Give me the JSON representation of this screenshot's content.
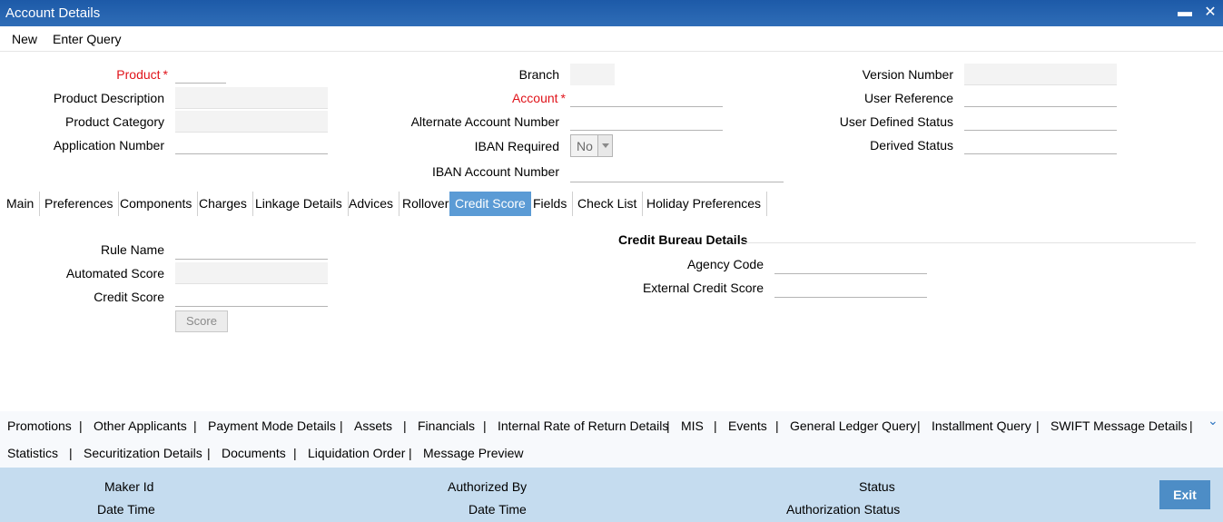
{
  "window": {
    "title": "Account Details",
    "minimize_glyph": "▬",
    "close_glyph": "✕"
  },
  "menu": {
    "new": "New",
    "enter_query": "Enter Query"
  },
  "header": {
    "product_label": "Product",
    "product_description_label": "Product Description",
    "product_category_label": "Product Category",
    "application_number_label": "Application Number",
    "branch_label": "Branch",
    "account_label": "Account",
    "alternate_account_label": "Alternate Account Number",
    "iban_required_label": "IBAN Required",
    "iban_required_value": "No",
    "iban_account_label": "IBAN Account Number",
    "version_number_label": "Version Number",
    "user_reference_label": "User Reference",
    "user_defined_status_label": "User Defined Status",
    "derived_status_label": "Derived Status",
    "required_marker": "*"
  },
  "tabs": [
    "Main",
    "Preferences",
    "Components",
    "Charges",
    "Linkage Details",
    "Advices",
    "Rollover",
    "Credit Score",
    "Fields",
    "Check List",
    "Holiday Preferences"
  ],
  "active_tab": "Credit Score",
  "credit_score": {
    "rule_name_label": "Rule Name",
    "automated_score_label": "Automated Score",
    "credit_score_label": "Credit Score",
    "score_button": "Score",
    "bureau_title": "Credit Bureau Details",
    "agency_code_label": "Agency Code",
    "external_credit_score_label": "External Credit Score"
  },
  "links": {
    "row1": [
      "Promotions",
      "Other Applicants",
      "Payment Mode Details",
      "Assets",
      "Financials",
      "Internal Rate of Return Details",
      "MIS",
      "Events",
      "General Ledger Query",
      "Installment Query",
      "SWIFT Message Details"
    ],
    "row2": [
      "Statistics",
      "Securitization Details",
      "Documents",
      "Liquidation Order",
      "Message Preview"
    ],
    "separator": "|",
    "expand_glyph": "⌄"
  },
  "footer": {
    "maker_id": "Maker Id",
    "date_time_1": "Date Time",
    "authorized_by": "Authorized By",
    "date_time_2": "Date Time",
    "status": "Status",
    "authorization_status": "Authorization Status",
    "exit": "Exit"
  },
  "colors": {
    "title_bar": "#2b66b1",
    "active_tab": "#5b9bd5",
    "required": "#e0131a",
    "footer": "#c5dcef",
    "exit_button": "#4d8dc6"
  }
}
